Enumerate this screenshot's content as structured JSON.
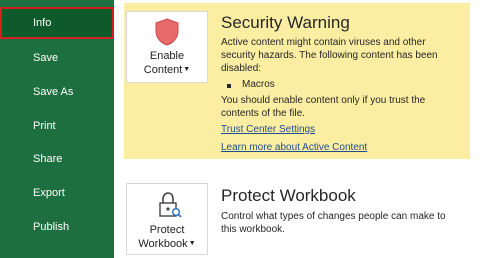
{
  "nav": {
    "items": [
      {
        "label": "Info"
      },
      {
        "label": "Save"
      },
      {
        "label": "Save As"
      },
      {
        "label": "Print"
      },
      {
        "label": "Share"
      },
      {
        "label": "Export"
      },
      {
        "label": "Publish"
      }
    ]
  },
  "security": {
    "button_line1": "Enable",
    "button_line2": "Content",
    "title": "Security Warning",
    "desc_line1": "Active content might contain viruses and other",
    "desc_line2": "security hazards. The following content has been",
    "desc_line3": "disabled:",
    "bullet_item": "Macros",
    "advice_line1": "You should enable content only if you trust the",
    "advice_line2": "contents of the file.",
    "link_trust": "Trust Center Settings",
    "link_learn": "Learn more about Active Content"
  },
  "protect": {
    "button_line1": "Protect",
    "button_line2": "Workbook",
    "title": "Protect Workbook",
    "desc_line1": "Control what types of changes people can make to",
    "desc_line2": "this workbook."
  },
  "colors": {
    "sidebar": "#1e6f3f",
    "selected_outline": "#d22020",
    "warning_panel": "#fbeea3",
    "link": "#1f4d8f",
    "shield": "#e86a6a"
  },
  "icons": {
    "enable_content": "shield-icon",
    "protect_workbook": "padlock-key-icon",
    "dropdown": "caret-down-icon"
  }
}
